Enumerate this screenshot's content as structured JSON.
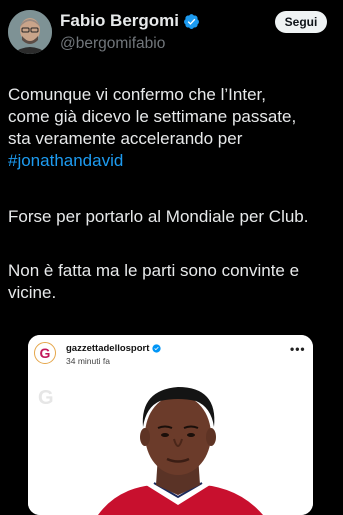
{
  "author": {
    "name": "Fabio Bergomi",
    "handle": "@bergomifabio",
    "verified": true,
    "follow_label": "Segui"
  },
  "tweet": {
    "line1": "Comunque vi confermo che l’Inter,\ncome già dicevo le settimane passate,\nsta veramente accelerando per",
    "hashtag": "#jonathandavid",
    "paragraph2": "Forse per portarlo al Mondiale per Club.",
    "paragraph3": "Non è fatta ma le parti sono convinte e\nvicine."
  },
  "embed": {
    "account_initial": "G",
    "account_name": "gazzettadellosport",
    "time": "34 minuti fa",
    "more": "•••",
    "watermark": "G"
  },
  "colors": {
    "background": "#000000",
    "text": "#e7e9ea",
    "secondary": "#71767b",
    "link": "#1d9bf0",
    "verified": "#1d9bf0",
    "follow_button_bg": "#eff3f4"
  }
}
